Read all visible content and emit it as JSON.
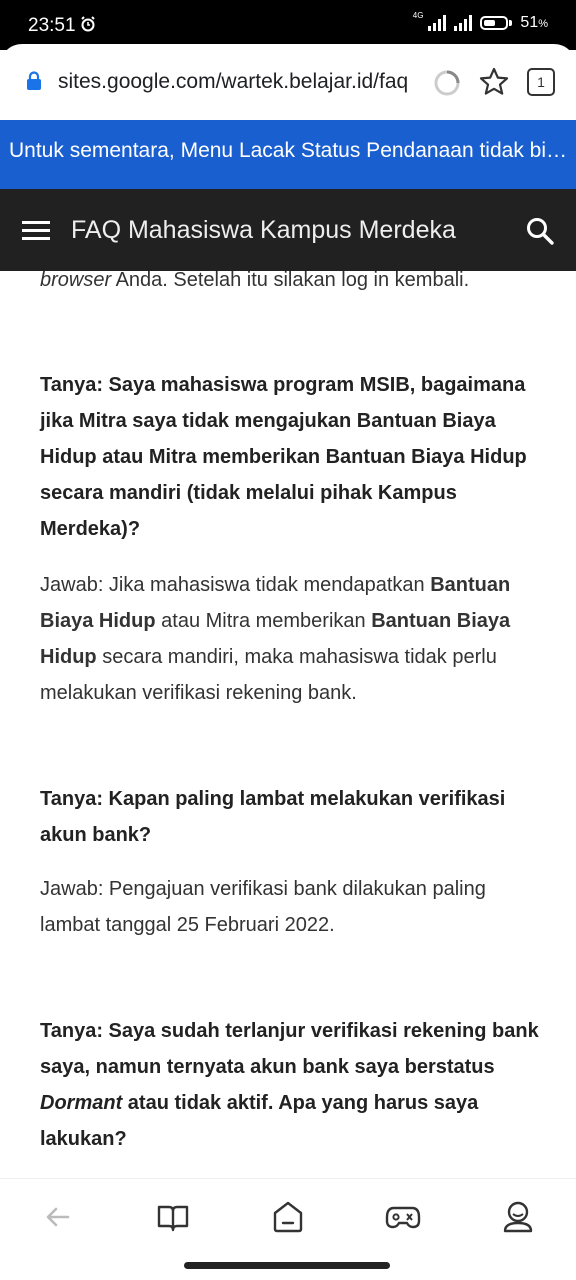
{
  "status": {
    "time": "23:51",
    "network": "4G",
    "battery": "51",
    "battery_unit": "%"
  },
  "browser": {
    "url": "sites.google.com/wartek.belajar.id/faq",
    "tab_count": "1"
  },
  "banner": {
    "text": "Untuk sementara, Menu Lacak Status Pendanaan tidak bisa diakses"
  },
  "header": {
    "title": "FAQ Mahasiswa Kampus Merdeka"
  },
  "content": {
    "partial_line": {
      "italic": "browser",
      "rest": " Anda. Setelah itu silakan log in kembali."
    },
    "q1": "Tanya: Saya mahasiswa program MSIB, bagaimana jika Mitra saya tidak mengajukan Bantuan Biaya Hidup atau Mitra memberikan Bantuan Biaya Hidup secara mandiri (tidak melalui pihak Kampus Merdeka)?",
    "a1": {
      "part1": "Jawab: Jika mahasiswa tidak mendapatkan ",
      "bold1": "Bantuan Biaya Hidup",
      "part2": " atau Mitra memberikan ",
      "bold2": "Bantuan Biaya Hidup",
      "part3": " secara mandiri, maka mahasiswa tidak perlu melakukan verifikasi rekening bank."
    },
    "q2": "Tanya: Kapan paling lambat melakukan verifikasi akun bank?",
    "a2": "Jawab: Pengajuan verifikasi bank dilakukan paling lambat tanggal 25 Februari 2022.",
    "q3": {
      "part1": "Tanya: Saya sudah terlanjur verifikasi rekening bank saya, namun ternyata akun bank saya berstatus ",
      "italic": "Dormant",
      "part2": " atau tidak aktif. Apa yang harus saya lakukan?"
    }
  },
  "icons": [
    "back-icon",
    "book-icon",
    "home-icon",
    "game-icon",
    "profile-icon"
  ]
}
